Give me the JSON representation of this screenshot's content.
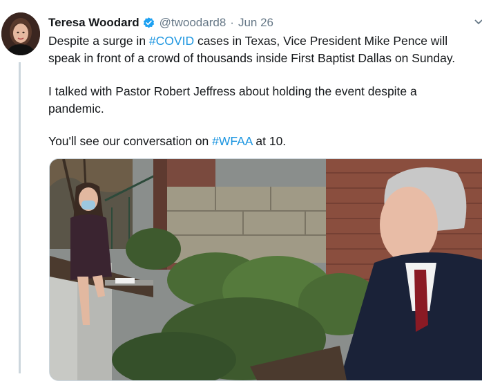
{
  "tweet": {
    "author_name": "Teresa Woodard",
    "handle": "@twoodard8",
    "separator": "·",
    "date": "Jun 26",
    "para1": {
      "pre": "Despite a surge in ",
      "hashtag": "#COVID",
      "post": " cases in Texas, Vice President Mike Pence will",
      "line2": "speak in front of a crowd of thousands inside First Baptist Dallas on Sunday."
    },
    "para2": {
      "line1": "I talked with Pastor Robert Jeffress about holding the event despite a",
      "line2": "pandemic."
    },
    "para3": {
      "pre": "You'll see our conversation on ",
      "hashtag": "#WFAA",
      "post": " at 10."
    }
  },
  "icons": {
    "verified": "verified-badge-icon",
    "more": "chevron-down-icon"
  },
  "colors": {
    "link": "#1b95e0",
    "verified": "#1da1f2",
    "text": "#14171a",
    "muted": "#657786"
  }
}
